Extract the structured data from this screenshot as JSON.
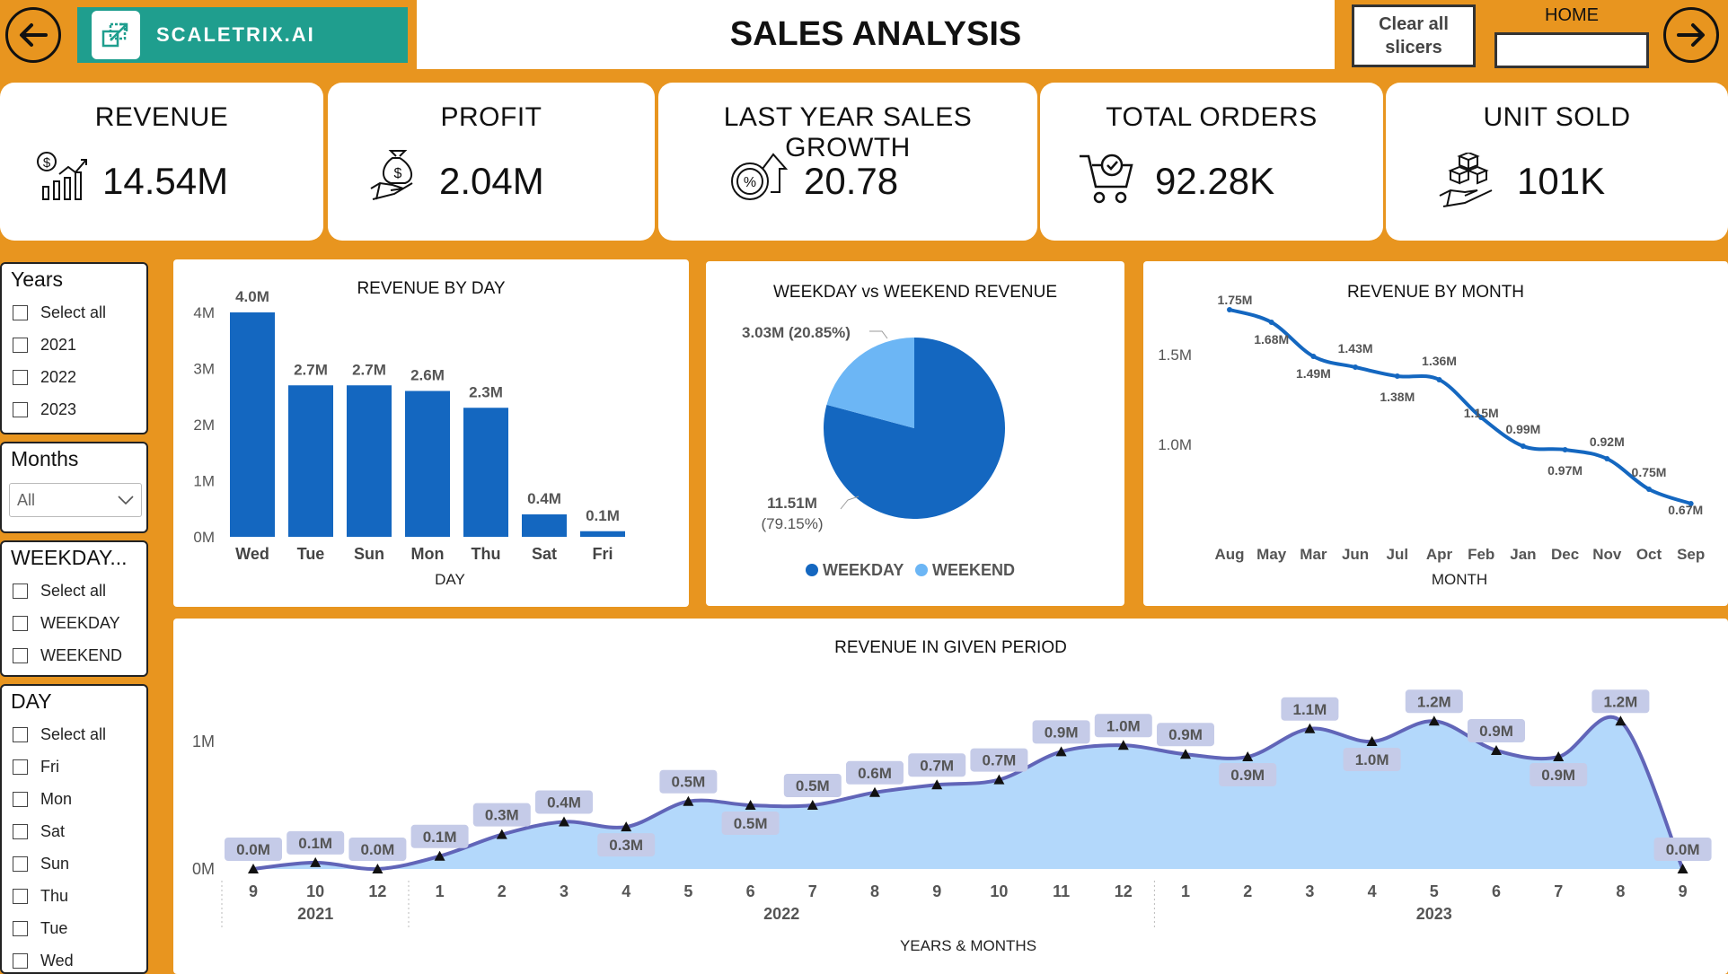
{
  "header": {
    "title": "SALES ANALYSIS",
    "logo_text": "SCALETRIX.AI",
    "clear_button": "Clear all slicers",
    "home_label": "HOME",
    "back_icon": "arrow-left-icon",
    "forward_icon": "arrow-right-icon"
  },
  "kpis": [
    {
      "title": "REVENUE",
      "value": "14.54M",
      "icon": "revenue-chart-icon"
    },
    {
      "title": "PROFIT",
      "value": "2.04M",
      "icon": "money-bag-hand-icon"
    },
    {
      "title": "LAST YEAR SALES GROWTH",
      "value": "20.78",
      "icon": "growth-arrow-icon"
    },
    {
      "title": "TOTAL ORDERS",
      "value": "92.28K",
      "icon": "shopping-cart-icon"
    },
    {
      "title": "UNIT SOLD",
      "value": "101K",
      "icon": "boxes-hand-icon"
    }
  ],
  "slicers": {
    "years": {
      "title": "Years",
      "options": [
        "Select all",
        "2021",
        "2022",
        "2023"
      ]
    },
    "months": {
      "title": "Months",
      "value": "All"
    },
    "weekday": {
      "title": "WEEKDAY...",
      "options": [
        "Select all",
        "WEEKDAY",
        "WEEKEND"
      ]
    },
    "day": {
      "title": "DAY",
      "options": [
        "Select all",
        "Fri",
        "Mon",
        "Sat",
        "Sun",
        "Thu",
        "Tue",
        "Wed"
      ]
    }
  },
  "colors": {
    "accent": "#e8951f",
    "teal": "#1f9e8e",
    "bar": "#1467c0",
    "light": "#6cb6f5",
    "area_line": "#6165b8",
    "area_fill": "#b3d8fb"
  },
  "chart_data": [
    {
      "type": "bar",
      "title": "REVENUE BY DAY",
      "xlabel": "DAY",
      "categories": [
        "Wed",
        "Tue",
        "Sun",
        "Mon",
        "Thu",
        "Sat",
        "Fri"
      ],
      "values": [
        4.0,
        2.7,
        2.7,
        2.6,
        2.3,
        0.4,
        0.1
      ],
      "labels": [
        "4.0M",
        "2.7M",
        "2.7M",
        "2.6M",
        "2.3M",
        "0.4M",
        "0.1M"
      ],
      "yticks": [
        "0M",
        "1M",
        "2M",
        "3M",
        "4M"
      ],
      "ylim": [
        0,
        4.5
      ]
    },
    {
      "type": "pie",
      "title": "WEEKDAY vs WEEKEND REVENUE",
      "slices": [
        {
          "name": "WEEKDAY",
          "value": 11.51,
          "label1": "11.51M",
          "label2": "(79.15%)"
        },
        {
          "name": "WEEKEND",
          "value": 3.03,
          "label1": "3.03M (20.85%)"
        }
      ],
      "legend": [
        "WEEKDAY",
        "WEEKEND"
      ]
    },
    {
      "type": "line",
      "title": "REVENUE BY MONTH",
      "xlabel": "MONTH",
      "categories": [
        "Aug",
        "May",
        "Mar",
        "Jun",
        "Jul",
        "Apr",
        "Feb",
        "Jan",
        "Dec",
        "Nov",
        "Oct",
        "Sep"
      ],
      "values": [
        1.75,
        1.68,
        1.49,
        1.43,
        1.38,
        1.36,
        1.15,
        0.99,
        0.97,
        0.92,
        0.75,
        0.67
      ],
      "labels": [
        "1.75M",
        "1.68M",
        "1.49M",
        "1.43M",
        "1.38M",
        "1.36M",
        "1.15M",
        "0.99M",
        "0.97M",
        "0.92M",
        "0.75M",
        "0.67M"
      ],
      "yticks": [
        "1.0M",
        "1.5M"
      ],
      "ylim": [
        0.6,
        1.8
      ]
    },
    {
      "type": "area",
      "title": "REVENUE IN GIVEN PERIOD",
      "xlabel": "YEARS & MONTHS",
      "months": [
        "9",
        "10",
        "12",
        "1",
        "2",
        "3",
        "4",
        "5",
        "6",
        "7",
        "8",
        "9",
        "10",
        "11",
        "12",
        "1",
        "2",
        "3",
        "4",
        "5",
        "6",
        "7",
        "8",
        "9"
      ],
      "years": [
        "2021",
        "2022",
        "2023"
      ],
      "values": [
        0.0,
        0.05,
        0.0,
        0.1,
        0.27,
        0.37,
        0.33,
        0.53,
        0.5,
        0.5,
        0.6,
        0.66,
        0.7,
        0.92,
        0.97,
        0.9,
        0.88,
        1.1,
        1.0,
        1.16,
        0.93,
        0.88,
        1.16,
        0.0
      ],
      "labels": [
        "0.0M",
        "0.1M",
        "0.0M",
        "0.1M",
        "0.3M",
        "0.4M",
        "0.3M",
        "0.5M",
        "0.5M",
        "0.5M",
        "0.6M",
        "0.7M",
        "0.7M",
        "0.9M",
        "1.0M",
        "0.9M",
        "0.9M",
        "1.1M",
        "1.0M",
        "1.2M",
        "0.9M",
        "0.9M",
        "1.2M",
        "0.0M"
      ],
      "yticks": [
        "0M",
        "1M"
      ],
      "ylim": [
        0,
        1.25
      ]
    }
  ]
}
